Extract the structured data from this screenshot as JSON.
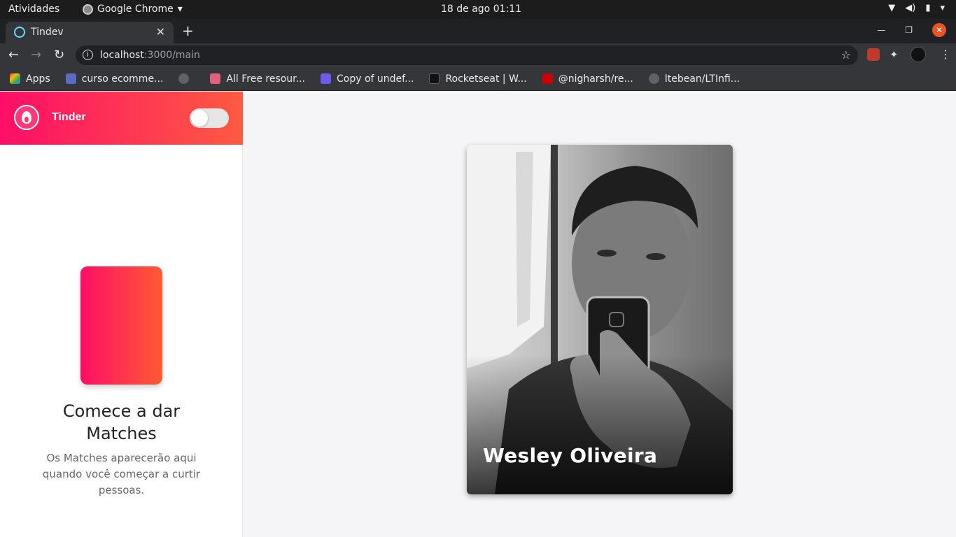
{
  "system_bar": {
    "activities": "Atividades",
    "app_name": "Google Chrome",
    "datetime": "18 de ago  01:11"
  },
  "browser": {
    "tab_title": "Tindev",
    "url_host": "localhost",
    "url_path": ":3000/main",
    "bookmarks": [
      {
        "label": "Apps",
        "icon": "apps-grid-icon",
        "color": "#ea4335"
      },
      {
        "label": "curso ecomme...",
        "icon": "doc-icon",
        "color": "#5c6bc0"
      },
      {
        "label": "",
        "icon": "github-icon",
        "color": "#9aa0a6"
      },
      {
        "label": "All Free resour...",
        "icon": "s-icon",
        "color": "#e0607e"
      },
      {
        "label": "Copy of undef...",
        "icon": "share-icon",
        "color": "#6c5ce7"
      },
      {
        "label": "Rocketseat | W...",
        "icon": "rocketseat-icon",
        "color": "#111111"
      },
      {
        "label": "@nigharsh/re...",
        "icon": "npm-icon",
        "color": "#cb0000"
      },
      {
        "label": "ltebean/LTInfi...",
        "icon": "github-icon",
        "color": "#9aa0a6"
      }
    ]
  },
  "sidebar": {
    "brand": "Tinder",
    "toggle_on": false,
    "empty_title": "Comece a dar Matches",
    "empty_subtitle": "Os Matches aparecerão aqui quando você começar a curtir pessoas."
  },
  "profile_card": {
    "name": "Wesley Oliveira"
  },
  "colors": {
    "gradient_start": "#fd0e67",
    "gradient_end": "#ff5a42"
  }
}
